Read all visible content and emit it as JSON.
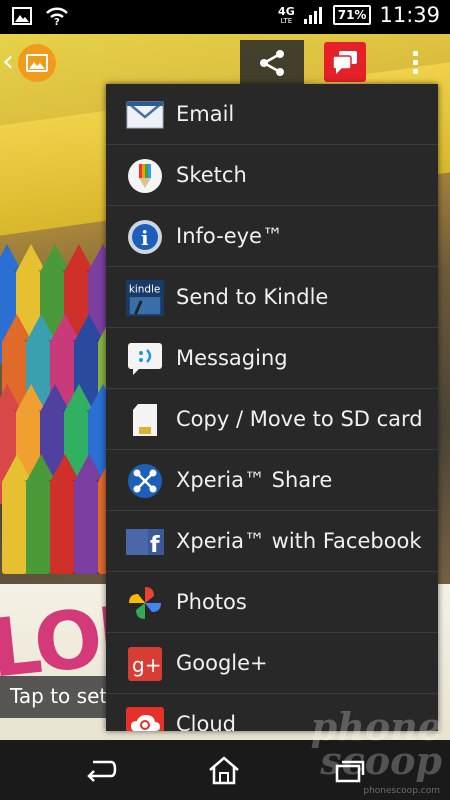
{
  "status_bar": {
    "network": "4G",
    "network_sub": "LTE",
    "battery": "71%",
    "time": "11:39"
  },
  "photo_overlay": {
    "tap_text": "Tap to set"
  },
  "share_menu": {
    "items": [
      {
        "label": "Email",
        "icon": "email-icon"
      },
      {
        "label": "Sketch",
        "icon": "sketch-icon"
      },
      {
        "label": "Info-eye™",
        "icon": "info-eye-icon"
      },
      {
        "label": "Send to Kindle",
        "icon": "kindle-icon"
      },
      {
        "label": "Messaging",
        "icon": "messaging-icon"
      },
      {
        "label": "Copy / Move to SD card",
        "icon": "sd-card-icon"
      },
      {
        "label": "Xperia™ Share",
        "icon": "xperia-share-icon"
      },
      {
        "label": "Xperia™ with Facebook",
        "icon": "facebook-icon"
      },
      {
        "label": "Photos",
        "icon": "photos-icon"
      },
      {
        "label": "Google+",
        "icon": "google-plus-icon"
      },
      {
        "label": "Cloud",
        "icon": "cloud-icon"
      }
    ]
  },
  "watermark": {
    "line1": "phone",
    "line2": "scoop",
    "url": "phonescoop.com"
  },
  "colors": {
    "menu_bg": "#282828",
    "accent_red": "#e42029",
    "album_orange": "#f29a1a"
  }
}
